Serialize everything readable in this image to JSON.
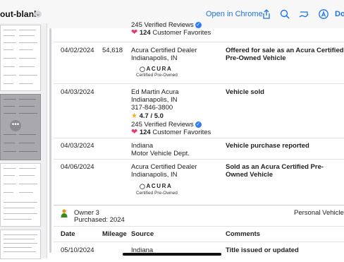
{
  "toolbar": {
    "title": "out-blank",
    "open_in_chrome": "Open in Chrome",
    "done": "Do"
  },
  "sidebar": {
    "more_label": "•••"
  },
  "history": {
    "top_partial": {
      "reviews": "245 Verified Reviews",
      "favorites_count": "124",
      "favorites_label": "Customer Favorites"
    },
    "rows": [
      {
        "date": "04/02/2024",
        "mileage": "54,618",
        "source_line1": "Acura Certified Dealer",
        "source_line2": "Indianapolis, IN",
        "brand": "ACURA",
        "brand_sub": "Certified Pre-Owned",
        "comment": "Offered for sale as an Acura Certified Pre-Owned Vehicle"
      },
      {
        "date": "04/03/2024",
        "mileage": "",
        "source_line1": "Ed Martin Acura",
        "source_line2": "Indianapolis, IN",
        "source_line3": "317-846-3800",
        "rating": "4.7 / 5.0",
        "reviews": "245 Verified Reviews",
        "favorites_count": "124",
        "favorites_label": "Customer Favorites",
        "comment": "Vehicle sold"
      },
      {
        "date": "04/03/2024",
        "mileage": "",
        "source_line1": "Indiana",
        "source_line2": "Motor Vehicle Dept.",
        "comment": "Vehicle purchase reported"
      },
      {
        "date": "04/06/2024",
        "mileage": "",
        "source_line1": "Acura Certified Dealer",
        "source_line2": "Indianapolis, IN",
        "brand": "ACURA",
        "brand_sub": "Certified Pre-Owned",
        "comment": "Sold as an Acura Certified Pre-Owned Vehicle"
      }
    ]
  },
  "owner3": {
    "title": "Owner 3",
    "purchased": "Purchased: 2024",
    "type": "Personal Vehicle",
    "columns": {
      "date": "Date",
      "mileage": "Mileage",
      "source": "Source",
      "comments": "Comments"
    },
    "row": {
      "date": "05/10/2024",
      "source": "Indiana",
      "comment": "Title issued or updated"
    }
  },
  "colors": {
    "link": "#1a73e8",
    "star": "#f2b01e",
    "heart": "#e23d6f",
    "verified": "#2e7cf6",
    "owner_icon": "#3d8b1f"
  },
  "icons": [
    "chevron-down-icon",
    "share-icon",
    "search-icon",
    "markup-icon",
    "accessibility-icon",
    "star-icon",
    "heart-icon",
    "verified-check-icon",
    "person-icon"
  ]
}
